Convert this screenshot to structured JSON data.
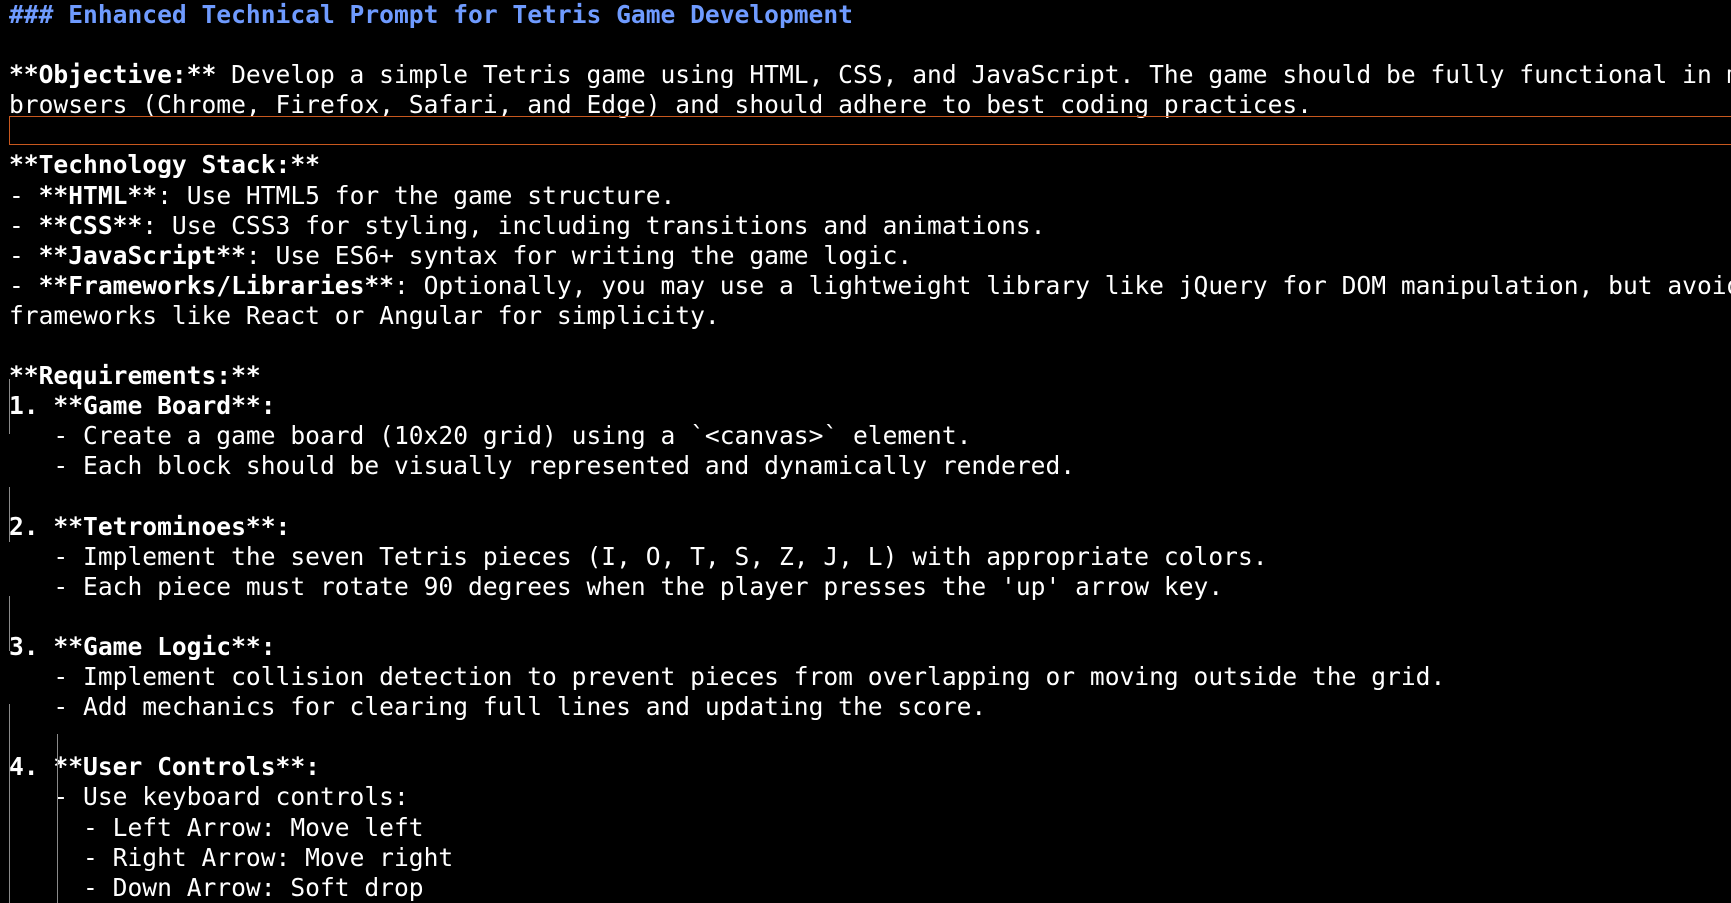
{
  "heading": "### Enhanced Technical Prompt for Tetris Game Development",
  "objective": {
    "label": "**Objective:**",
    "text1": " Develop a simple Tetris game using HTML, CSS, and JavaScript. The game should be fully functional in modern web",
    "text2": "browsers (Chrome, Firefox, Safari, and Edge) and should adhere to best coding practices."
  },
  "tech": {
    "title": "**Technology Stack:**",
    "items": [
      {
        "prefix": "- ",
        "label": "**HTML**",
        "text": ": Use HTML5 for the game structure."
      },
      {
        "prefix": "- ",
        "label": "**CSS**",
        "text": ": Use CSS3 for styling, including transitions and animations."
      },
      {
        "prefix": "- ",
        "label": "**JavaScript**",
        "text": ": Use ES6+ syntax for writing the game logic."
      },
      {
        "prefix": "- ",
        "label": "**Frameworks/Libraries**",
        "text": ": Optionally, you may use a lightweight library like jQuery for DOM manipulation, but avoid heavy"
      }
    ],
    "wrap": "frameworks like React or Angular for simplicity."
  },
  "requirements": {
    "title": "**Requirements:**",
    "sections": [
      {
        "num": "1. ",
        "label": "**Game Board**",
        "colon": ":",
        "items": [
          "- Create a game board (10x20 grid) using a `<canvas>` element.",
          "- Each block should be visually represented and dynamically rendered."
        ]
      },
      {
        "num": "2. ",
        "label": "**Tetrominoes**",
        "colon": ":",
        "items": [
          "- Implement the seven Tetris pieces (I, O, T, S, Z, J, L) with appropriate colors.",
          "- Each piece must rotate 90 degrees when the player presses the 'up' arrow key."
        ]
      },
      {
        "num": "3. ",
        "label": "**Game Logic**",
        "colon": ":",
        "items": [
          "- Implement collision detection to prevent pieces from overlapping or moving outside the grid.",
          "- Add mechanics for clearing full lines and updating the score."
        ]
      },
      {
        "num": "4. ",
        "label": "**User Controls**",
        "colon": ":",
        "items": [
          "- Use keyboard controls:"
        ],
        "subitems": [
          "- Left Arrow: Move left",
          "- Right Arrow: Move right",
          "- Down Arrow: Soft drop"
        ]
      }
    ]
  },
  "colors": {
    "background": "#000000",
    "text": "#ffffff",
    "heading": "#6f9bff",
    "cursorline_border": "#c8581e",
    "guide": "#8a8a8a"
  }
}
